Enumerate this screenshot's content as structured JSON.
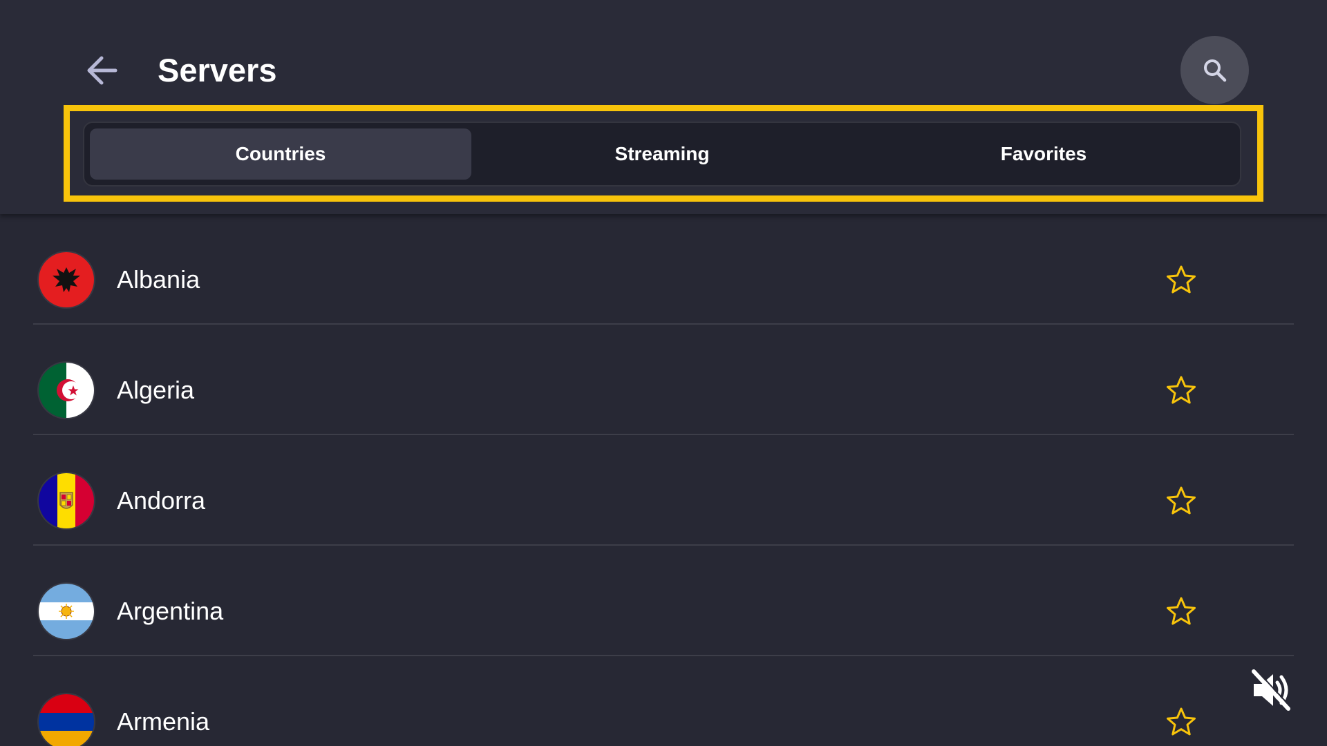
{
  "header": {
    "title": "Servers"
  },
  "tabs": [
    {
      "label": "Countries",
      "active": true
    },
    {
      "label": "Streaming",
      "active": false
    },
    {
      "label": "Favorites",
      "active": false
    }
  ],
  "countries": [
    {
      "name": "Albania",
      "flag": "albania-flag-icon"
    },
    {
      "name": "Algeria",
      "flag": "algeria-flag-icon"
    },
    {
      "name": "Andorra",
      "flag": "andorra-flag-icon"
    },
    {
      "name": "Argentina",
      "flag": "argentina-flag-icon"
    },
    {
      "name": "Armenia",
      "flag": "armenia-flag-icon"
    }
  ],
  "colors": {
    "background": "#272834",
    "highlight": "#f8c40b",
    "star": "#f8c40b",
    "active_tab": "#3a3b4a"
  },
  "icons": {
    "back": "back-arrow-icon",
    "search": "search-icon",
    "favorite": "star-outline-icon",
    "mute": "muted-speaker-icon"
  }
}
